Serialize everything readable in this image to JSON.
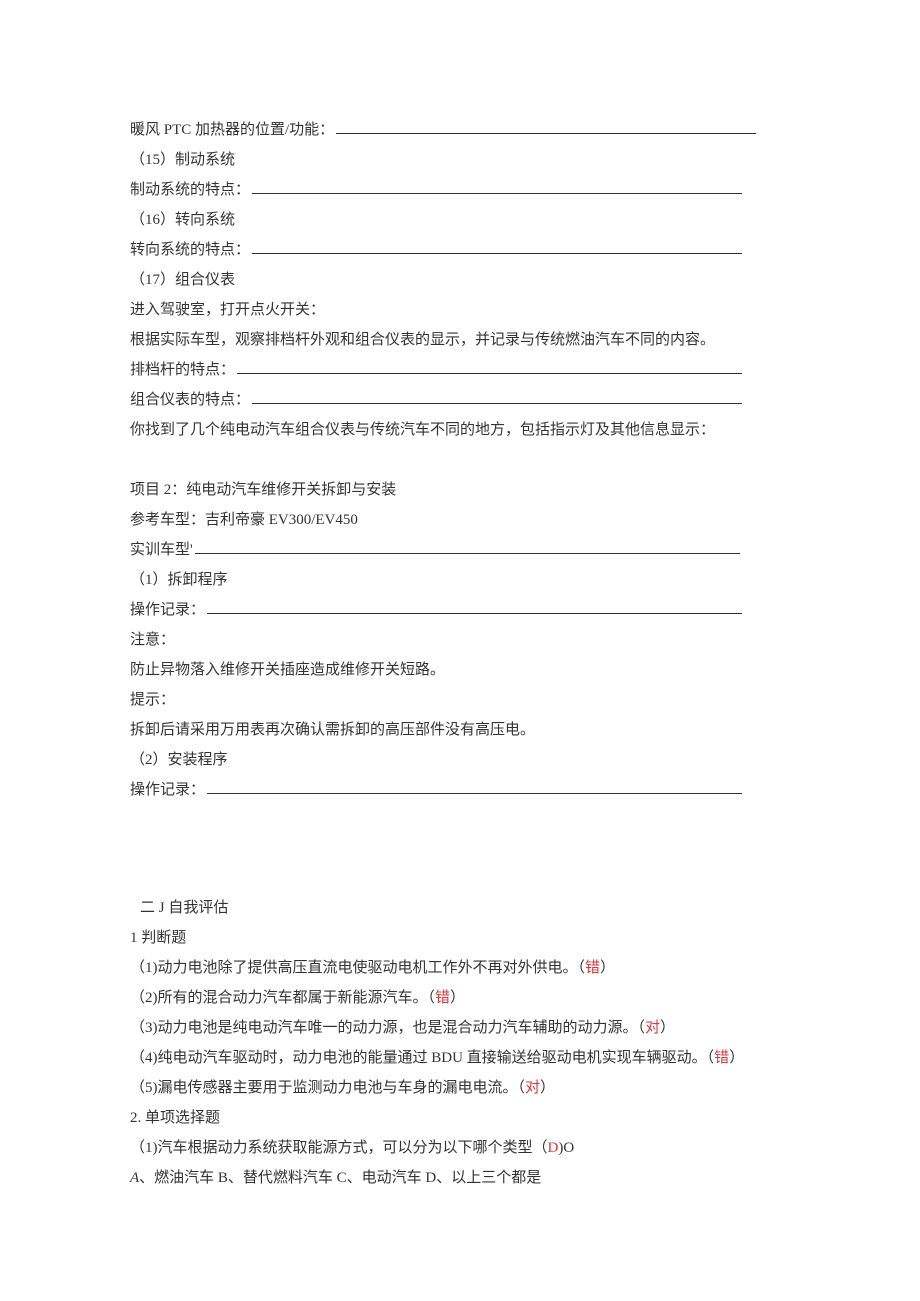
{
  "section1": {
    "line_ptc": "暖风 PTC 加热器的位置/功能：",
    "item15_heading": "（15）制动系统",
    "item15_line": "制动系统的特点：",
    "item16_heading": "（16）转向系统",
    "item16_line": "转向系统的特点：",
    "item17_heading": "（17）组合仪表",
    "item17_line1": "进入驾驶室，打开点火开关：",
    "item17_line2": "根据实际车型，观察排档杆外观和组合仪表的显示，并记录与传统燃油汽车不同的内容。",
    "item17_line3": "排档杆的特点：",
    "item17_line4": "组合仪表的特点：",
    "item17_line5": "你找到了几个纯电动汽车组合仪表与传统汽车不同的地方，包括指示灯及其他信息显示："
  },
  "section2": {
    "project_title": "项目 2：纯电动汽车维修开关拆卸与安装",
    "ref_model": "参考车型：吉利帝豪 EV300/EV450",
    "train_model": "实训车型'",
    "step1_heading": "（1）拆卸程序",
    "step1_record": "操作记录：",
    "note_label": "注意：",
    "note_text": "防止异物落入维修开关插座造成维修开关短路。",
    "tip_label": "提示：",
    "tip_text": "拆卸后请采用万用表再次确认需拆卸的高压部件没有高压电。",
    "step2_heading": "（2）安装程序",
    "step2_record": "操作记录："
  },
  "assessment": {
    "heading": "二 J 自我评估",
    "part1_heading": "1 判断题",
    "q1_prefix": "（1)动力电池除了提供高压直流电使驱动电机工作外不再对外供电。（",
    "q1_answer": "错",
    "q2_prefix": "（2)所有的混合动力汽车都属于新能源汽车。（",
    "q2_answer": "错",
    "q3_prefix": "（3)动力电池是纯电动汽车唯一的动力源，也是混合动力汽车辅助的动力源。（",
    "q3_answer": "对",
    "q4_prefix": "（4)纯电动汽车驱动时，动力电池的能量通过 BDU 直接输送给驱动电机实现车辆驱动。（",
    "q4_answer": "错",
    "q5_prefix": "（5)漏电传感器主要用于监测动力电池与车身的漏电电流。（",
    "q5_answer": "对",
    "closing": "）",
    "part2_heading": "2. 单项选择题",
    "mc1_prefix": "（1)汽车根据动力系统获取能源方式，可以分为以下哪个类型（",
    "mc1_answer": "D",
    "mc1_suffix": ")O",
    "mc1_opts_prefixA": "A",
    "mc1_opts_rest": "、燃油汽车 B、替代燃料汽车 C、电动汽车 D、以上三个都是"
  }
}
